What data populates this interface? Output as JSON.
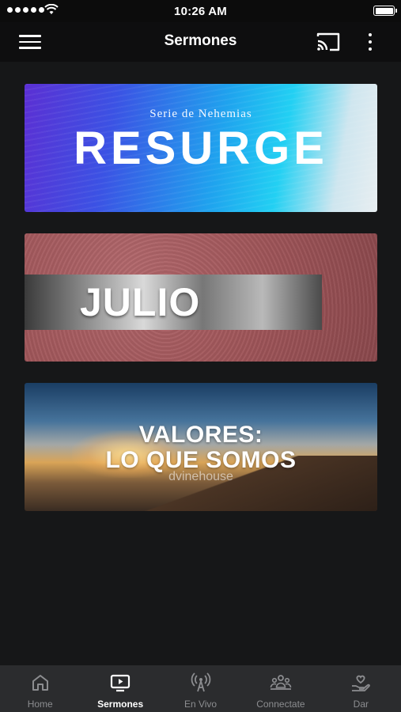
{
  "status_bar": {
    "time": "10:26 AM"
  },
  "header": {
    "title": "Sermones"
  },
  "cards": [
    {
      "subtitle": "Serie de Nehemias",
      "title": "RESURGE"
    },
    {
      "title": "JULIO"
    },
    {
      "title_line1": "VALORES:",
      "title_line2": "LO QUE SOMOS",
      "brand": "dvinehouse"
    }
  ],
  "tabs": [
    {
      "label": "Home",
      "icon": "home-icon"
    },
    {
      "label": "Sermones",
      "icon": "tv-play-icon",
      "active": true
    },
    {
      "label": "En Vivo",
      "icon": "broadcast-icon"
    },
    {
      "label": "Connectate",
      "icon": "people-icon"
    },
    {
      "label": "Dar",
      "icon": "hand-heart-icon"
    }
  ],
  "colors": {
    "active_tab": "#ffffff",
    "inactive_tab": "#8c8d90",
    "tab_bar_bg": "#2b2c2e",
    "page_bg": "#161718"
  }
}
